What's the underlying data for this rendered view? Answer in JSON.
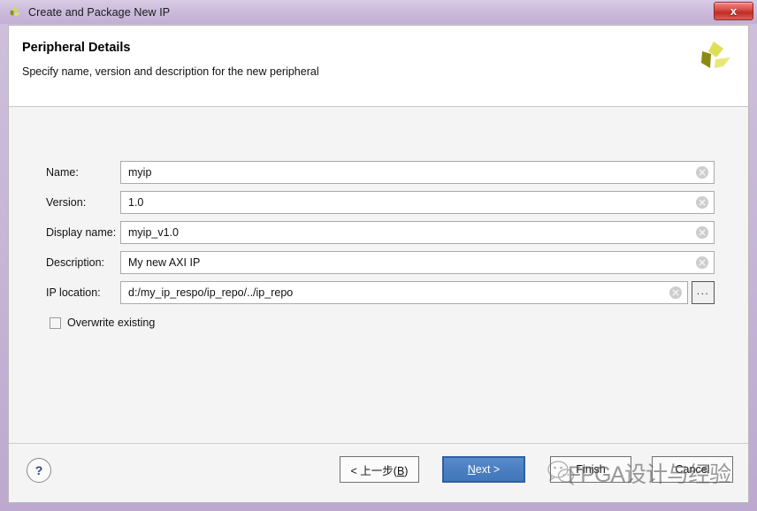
{
  "window": {
    "title": "Create and Package New IP",
    "logo_icon": "xilinx-pinwheel-icon",
    "close_label": "x"
  },
  "header": {
    "title": "Peripheral Details",
    "subtitle": "Specify name, version and description for the new peripheral",
    "logo_icon": "xilinx-pinwheel-icon"
  },
  "form": {
    "fields": [
      {
        "label": "Name:",
        "value": "myip",
        "placeholder": "",
        "clear_icon": "clear-circle-icon"
      },
      {
        "label": "Version:",
        "value": "1.0",
        "placeholder": "",
        "clear_icon": "clear-circle-icon"
      },
      {
        "label": "Display name:",
        "value": "myip_v1.0",
        "placeholder": "",
        "clear_icon": "clear-circle-icon"
      },
      {
        "label": "Description:",
        "value": "My new AXI IP",
        "placeholder": "",
        "clear_icon": "clear-circle-icon"
      },
      {
        "label": "IP location:",
        "value": "d:/my_ip_respo/ip_repo/../ip_repo",
        "placeholder": "",
        "clear_icon": "clear-circle-icon"
      }
    ],
    "browse_label": "...",
    "checkbox": {
      "label": "Overwrite existing",
      "checked": false
    }
  },
  "footer": {
    "help_label": "?",
    "back_label": "< 上一步(B)",
    "back_mnemonic": "B",
    "next_label": "Next >",
    "next_mnemonic": "N",
    "finish_label": "Finish",
    "cancel_label": "Cancel"
  },
  "watermark": {
    "text": "FPGA设计与经验",
    "icon": "wechat-icon"
  },
  "colors": {
    "titlebar": "#cdbcdc",
    "frame": "#c5b4d6",
    "body": "#f4f4f4",
    "header": "#ffffff",
    "primary_button": "#4a7fc1",
    "close_button": "#d8544c",
    "help_mark": "#2d4a83",
    "logo": "#c8c832"
  }
}
